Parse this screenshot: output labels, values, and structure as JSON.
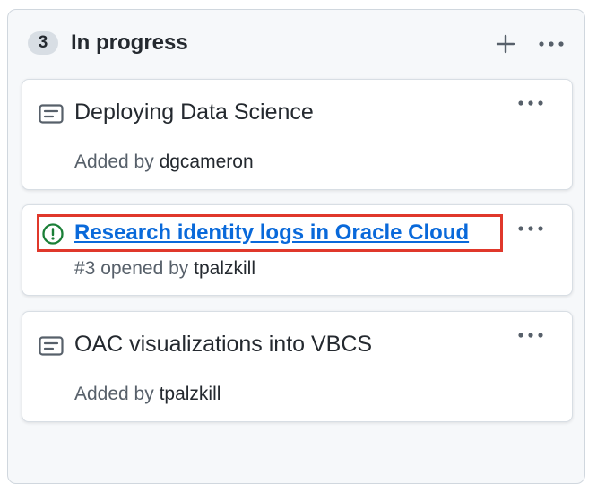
{
  "column": {
    "count": "3",
    "title": "In progress"
  },
  "cards": [
    {
      "type": "draft",
      "icon": "note-icon",
      "title": "Deploying Data Science",
      "meta_prefix": "Added by ",
      "meta_user": "dgcameron"
    },
    {
      "type": "issue",
      "icon": "issue-opened-icon",
      "title": "Research identity logs in Oracle Cloud",
      "meta_prefix": "#3 opened by ",
      "meta_user": "tpalzkill"
    },
    {
      "type": "draft",
      "icon": "note-icon",
      "title": "OAC visualizations into VBCS",
      "meta_prefix": "Added by ",
      "meta_user": "tpalzkill"
    }
  ],
  "colors": {
    "link": "#0969da",
    "highlight": "#e0382b",
    "issue_open": "#1a7f37"
  }
}
